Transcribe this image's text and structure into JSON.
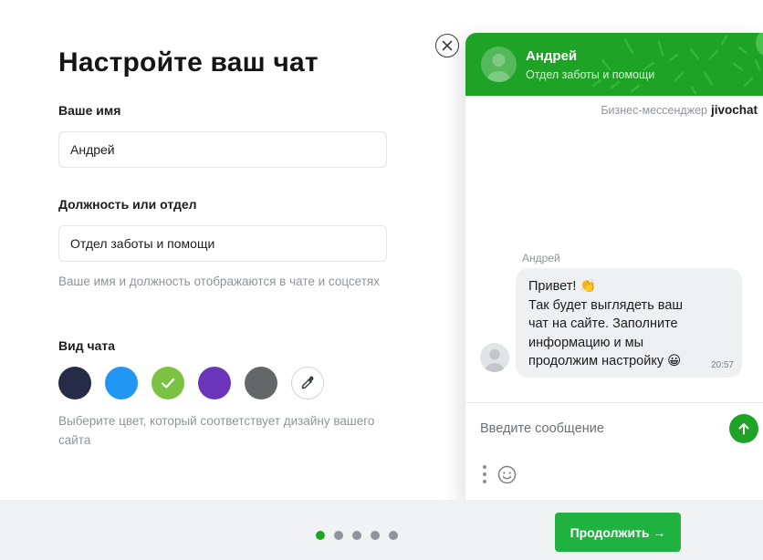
{
  "settings": {
    "title": "Настройте ваш чат",
    "name_label": "Ваше имя",
    "name_value": "Андрей",
    "position_label": "Должность или отдел",
    "position_value": "Отдел заботы и помощи",
    "name_hint": "Ваше имя и должность отображаются в чате и соцсетях",
    "theme_label": "Вид чата",
    "colors": [
      {
        "name": "navy",
        "hex": "#262c47",
        "selected": false
      },
      {
        "name": "blue",
        "hex": "#2196f3",
        "selected": false
      },
      {
        "name": "green",
        "hex": "#7cc242",
        "selected": true
      },
      {
        "name": "purple",
        "hex": "#6a35bb",
        "selected": false
      },
      {
        "name": "gray",
        "hex": "#646668",
        "selected": false
      }
    ],
    "picker_icon": "eyedropper-icon",
    "color_hint": "Выберите цвет, который соответствует дизайну вашего сайта"
  },
  "widget": {
    "close_icon": "close-icon",
    "header_color": "#1fa327",
    "agent_name": "Андрей",
    "agent_department": "Отдел заботы и помощи",
    "brand_text": "Бизнес-мессенджер",
    "brand_logo": "jivochat",
    "message": {
      "author": "Андрей",
      "lines": [
        "Привет! 👏",
        "Так будет выглядеть ваш",
        "чат на сайте. Заполните",
        "информацию и мы",
        "продолжим настройку 😀"
      ],
      "time": "20:57"
    },
    "input_placeholder": "Введите сообщение",
    "send_icon": "arrow-up-icon",
    "more_icon": "more-vertical-icon",
    "emoji_icon": "smile-icon"
  },
  "footer": {
    "steps_total": 5,
    "current_step": 1,
    "continue_label": "Продолжить →",
    "accent": "#1fb240"
  }
}
